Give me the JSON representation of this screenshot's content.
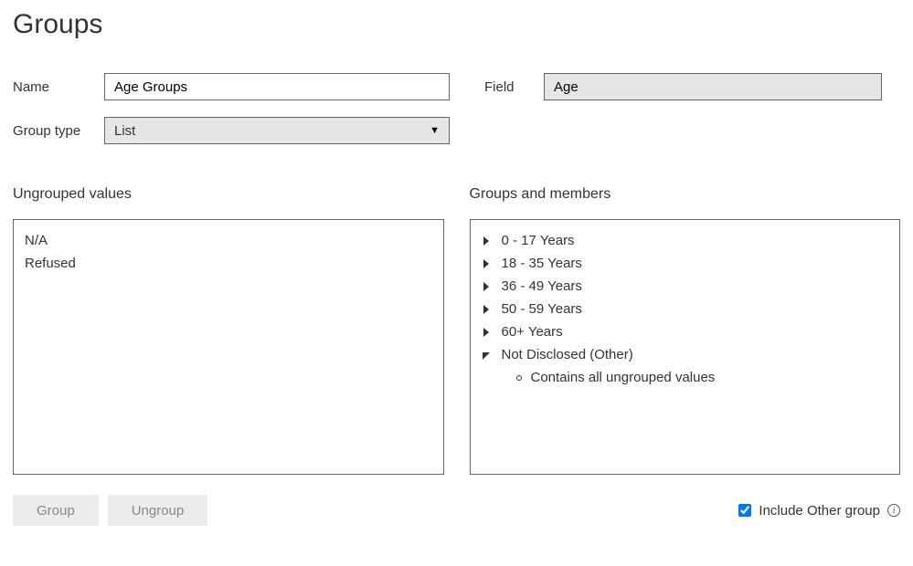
{
  "title": "Groups",
  "form": {
    "name_label": "Name",
    "name_value": "Age Groups",
    "field_label": "Field",
    "field_value": "Age",
    "group_type_label": "Group type",
    "group_type_value": "List"
  },
  "left": {
    "heading": "Ungrouped values",
    "items": [
      "N/A",
      "Refused"
    ]
  },
  "right": {
    "heading": "Groups and members",
    "groups": [
      {
        "label": "0 - 17 Years",
        "expanded": false
      },
      {
        "label": "18 - 35 Years",
        "expanded": false
      },
      {
        "label": "36 - 49 Years",
        "expanded": false
      },
      {
        "label": "50 - 59 Years",
        "expanded": false
      },
      {
        "label": "60+ Years",
        "expanded": false
      },
      {
        "label": "Not Disclosed (Other)",
        "expanded": true,
        "child": "Contains all ungrouped values"
      }
    ]
  },
  "buttons": {
    "group": "Group",
    "ungroup": "Ungroup"
  },
  "include_other": {
    "label": "Include Other group",
    "checked": true
  }
}
